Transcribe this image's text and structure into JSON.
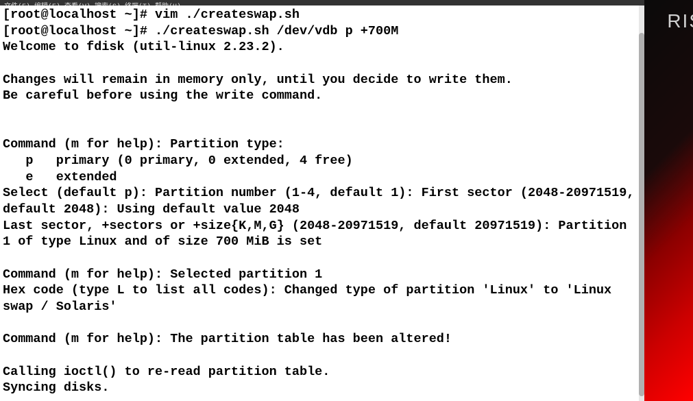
{
  "backdrop": {
    "text_fragment": "RIS"
  },
  "menubar": {
    "raw": "文件(F)  编辑(E)  查看(V)  搜索(S)  终端(T)  帮助(H)"
  },
  "terminal": {
    "prompt1": "[root@localhost ~]# ",
    "command1": "vim ./createswap.sh",
    "prompt2": "[root@localhost ~]# ",
    "command2": "./createswap.sh /dev/vdb p +700M",
    "line3": "Welcome to fdisk (util-linux 2.23.2).",
    "blank1": "",
    "line4": "Changes will remain in memory only, until you decide to write them.",
    "line5": "Be careful before using the write command.",
    "blank2": "",
    "blank3": "",
    "line6": "Command (m for help): Partition type:",
    "line7": "   p   primary (0 primary, 0 extended, 4 free)",
    "line8": "   e   extended",
    "line9": "Select (default p): Partition number (1-4, default 1): First sector (2048-20971519, default 2048): Using default value 2048",
    "line10": "Last sector, +sectors or +size{K,M,G} (2048-20971519, default 20971519): Partition 1 of type Linux and of size 700 MiB is set",
    "blank4": "",
    "line11": "Command (m for help): Selected partition 1",
    "line12": "Hex code (type L to list all codes): Changed type of partition 'Linux' to 'Linux swap / Solaris'",
    "blank5": "",
    "line13": "Command (m for help): The partition table has been altered!",
    "blank6": "",
    "line14": "Calling ioctl() to re-read partition table.",
    "line15": "Syncing disks."
  }
}
